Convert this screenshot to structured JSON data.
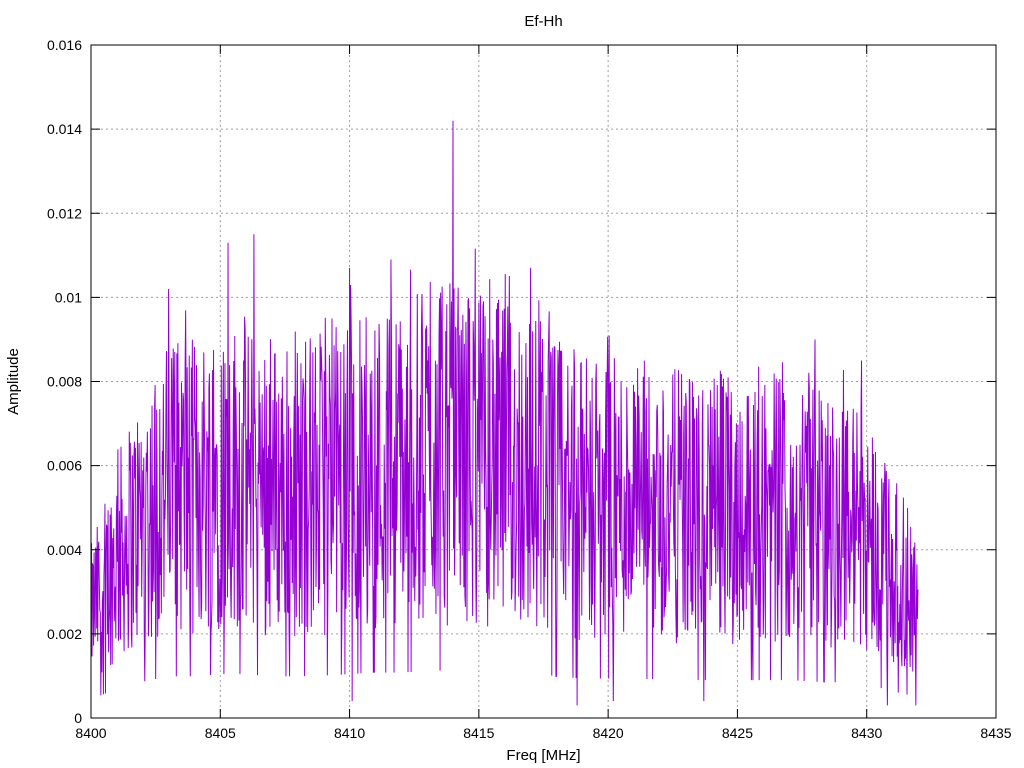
{
  "chart_data": {
    "type": "line",
    "title": "Ef-Hh",
    "xlabel": "Freq [MHz]",
    "ylabel": "Amplitude",
    "xlim": [
      8400,
      8435
    ],
    "ylim": [
      0,
      0.016
    ],
    "xticks": [
      "8400",
      "8405",
      "8410",
      "8415",
      "8420",
      "8425",
      "8430",
      "8435"
    ],
    "yticks": [
      "0",
      "0.002",
      "0.004",
      "0.006",
      "0.008",
      "0.01",
      "0.012",
      "0.014",
      "0.016"
    ],
    "grid": true,
    "line_color": "#9400d3",
    "series": [
      {
        "x_start": 8400,
        "x_end": 8432,
        "envelope_x": [
          8400,
          8401,
          8402,
          8403,
          8404,
          8405,
          8406,
          8407,
          8408,
          8409,
          8410,
          8411,
          8412,
          8413,
          8414,
          8415,
          8416,
          8417,
          8418,
          8419,
          8420,
          8421,
          8422,
          8423,
          8424,
          8425,
          8426,
          8427,
          8428,
          8429,
          8430,
          8431,
          8432
        ],
        "envelope_y": [
          0.0025,
          0.0038,
          0.0048,
          0.0055,
          0.0055,
          0.0058,
          0.0058,
          0.0055,
          0.0055,
          0.0056,
          0.0058,
          0.006,
          0.006,
          0.0062,
          0.0063,
          0.0062,
          0.006,
          0.006,
          0.0055,
          0.0052,
          0.0052,
          0.0052,
          0.0051,
          0.005,
          0.005,
          0.005,
          0.005,
          0.005,
          0.0048,
          0.0047,
          0.0045,
          0.0035,
          0.0028
        ],
        "peaks": [
          {
            "x": 8403.0,
            "y": 0.0102
          },
          {
            "x": 8405.3,
            "y": 0.0113
          },
          {
            "x": 8406.3,
            "y": 0.0115
          },
          {
            "x": 8410.0,
            "y": 0.0107
          },
          {
            "x": 8411.6,
            "y": 0.0109
          },
          {
            "x": 8414.0,
            "y": 0.0142
          },
          {
            "x": 8417.0,
            "y": 0.0107
          },
          {
            "x": 8428.0,
            "y": 0.009
          },
          {
            "x": 8429.8,
            "y": 0.0085
          }
        ],
        "troughs": [
          {
            "x": 8410.1,
            "y": 0.0004
          },
          {
            "x": 8418.8,
            "y": 0.0003
          },
          {
            "x": 8420.2,
            "y": 0.0004
          },
          {
            "x": 8423.7,
            "y": 0.0004
          },
          {
            "x": 8430.8,
            "y": 0.0003
          },
          {
            "x": 8431.9,
            "y": 0.0003
          }
        ]
      }
    ]
  }
}
